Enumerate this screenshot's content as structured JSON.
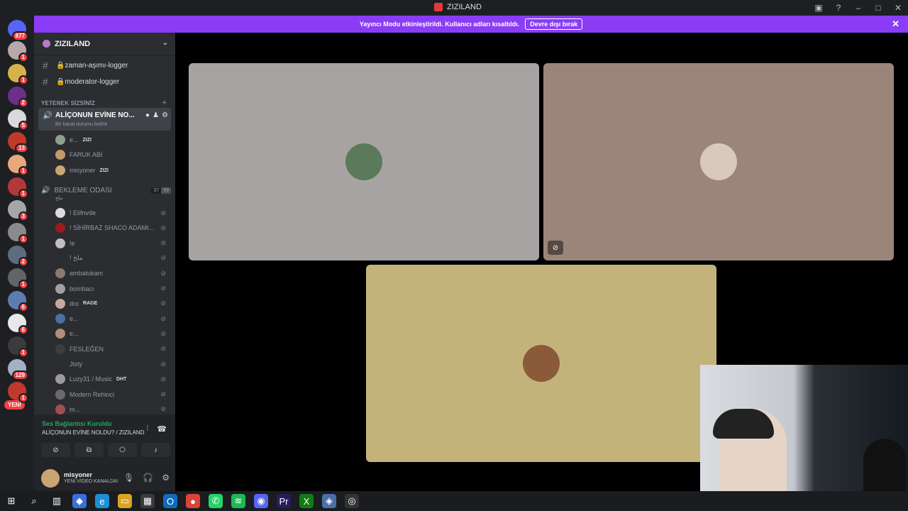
{
  "window": {
    "title": "ZIZILAND"
  },
  "banner": {
    "text": "Yayıncı Modu etkinleştirildi. Kullanıcı adları kısaltıldı.",
    "button": "Devre dışı bırak"
  },
  "guilds": {
    "home_badge": "877",
    "new_label": "YENİ",
    "items": [
      {
        "badge": "1",
        "color": "#b7a9a9"
      },
      {
        "badge": "1",
        "color": "#d6b24a"
      },
      {
        "badge": "2",
        "color": "#6c2f8a"
      },
      {
        "badge": "5",
        "color": "#d9d9d9"
      },
      {
        "badge": "13",
        "color": "#c0392b"
      },
      {
        "badge": "1",
        "color": "#e8a87c"
      },
      {
        "badge": "1",
        "color": "#b33939"
      },
      {
        "badge": "3",
        "color": "#a6a6a6"
      },
      {
        "badge": "1",
        "color": "#8a8a8a"
      },
      {
        "badge": "2",
        "color": "#5d6d7e"
      },
      {
        "badge": "1",
        "color": "#626567"
      },
      {
        "badge": "6",
        "color": "#5b7db1"
      },
      {
        "badge": "6",
        "color": "#e8e8e8"
      },
      {
        "badge": "1",
        "color": "#3b3b3b"
      },
      {
        "badge": "129",
        "color": "#a3b1c2"
      },
      {
        "badge": "1",
        "color": "#c0392b"
      }
    ]
  },
  "server": {
    "name": "ZIZILAND",
    "text_channels": [
      "🔒zaman-aşımı-logger",
      "🔒moderator-logger"
    ],
    "category": "YETENEK SİZSİNİZ",
    "voice_channel": {
      "name": "ALİÇONUN EVİNE NO...",
      "status": "Bir kanal durumu belirle",
      "members": [
        {
          "name": "e...",
          "tag": "ZIZI",
          "color": "#8fa08a"
        },
        {
          "name": "FARUK ABİ",
          "tag": "",
          "color": "#c49a6c"
        },
        {
          "name": "misyoner",
          "tag": "ZIZI",
          "color": "#c9a574"
        }
      ]
    },
    "waiting_room": {
      "name": "BEKLEME ODASI",
      "count": "37",
      "limit": "99",
      "sub": "ملح",
      "members": [
        {
          "name": "! Elifnvde",
          "tag": "",
          "color": "#dcdcdc"
        },
        {
          "name": "! SİHİRBAZ SHACO ADAMI...",
          "tag": "",
          "color": "#9b1c1c"
        },
        {
          "name": "!e",
          "tag": "",
          "color": "#bfbfbf"
        },
        {
          "name": "!          ملح",
          "tag": "",
          "color": "#2b2d31"
        },
        {
          "name": "ambatukam",
          "tag": "",
          "color": "#8c7b6b"
        },
        {
          "name": "bombacı",
          "tag": "",
          "color": "#a0a0a0"
        },
        {
          "name": "dro",
          "tag": "RAGE",
          "color": "#c7a8a0"
        },
        {
          "name": "e...",
          "tag": "",
          "color": "#4a6fa5"
        },
        {
          "name": "e...",
          "tag": "",
          "color": "#b08d7e"
        },
        {
          "name": "FESLEĞEN",
          "tag": "",
          "color": "#3d3d3d"
        },
        {
          "name": "Jisty",
          "tag": "",
          "color": "#2b2d31"
        },
        {
          "name": "Luzy31 / Music",
          "tag": "DHT",
          "color": "#9a9a9a"
        },
        {
          "name": "Modern Rehinci",
          "tag": "",
          "color": "#6b6b6b"
        },
        {
          "name": "m...",
          "tag": "",
          "color": "#a05050"
        }
      ]
    }
  },
  "voice_panel": {
    "status": "Ses Bağlantısı Kuruldu",
    "channel": "ALİÇONUN EVİNE NOLDU? / ZIZILAND"
  },
  "user": {
    "name": "misyoner",
    "status": "YENİ VİDEO KANALDA!"
  },
  "stage": {
    "tiles": [
      {
        "bg": "#a8a3a3",
        "avatar": "#5a7a5a"
      },
      {
        "bg": "#9b857b",
        "avatar": "#d8c8be"
      },
      {
        "bg": "#c3b37b",
        "avatar": "#8a5a3a"
      }
    ]
  }
}
